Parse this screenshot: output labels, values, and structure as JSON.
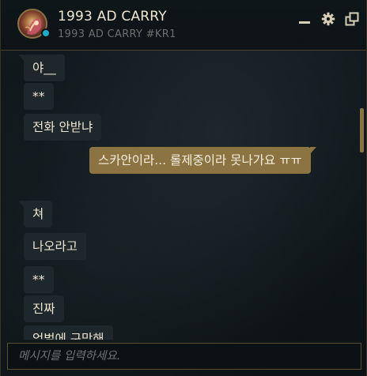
{
  "header": {
    "title": "1993 AD CARRY",
    "subtitle": "1993 AD CARRY #KR1",
    "status": "online",
    "status_color": "#1ab0c9",
    "icons": [
      "minimize-icon",
      "gear-icon",
      "popout-icon"
    ]
  },
  "messages": [
    {
      "dir": "in",
      "text": "야__"
    },
    {
      "dir": "in",
      "text": "**"
    },
    {
      "dir": "in",
      "text": "전화 안받냐"
    },
    {
      "dir": "out",
      "text": "스카안이라... 롤제중이라 못나가요 ㅠㅠ"
    },
    {
      "dir": "in",
      "text": "쳐"
    },
    {
      "dir": "in",
      "text": "나오라고"
    },
    {
      "dir": "in",
      "text": "**"
    },
    {
      "dir": "in",
      "text": "진짜"
    },
    {
      "dir": "in",
      "text": "엄벌에 구막해"
    }
  ],
  "input": {
    "placeholder": "메시지를 입력하세요."
  },
  "colors": {
    "accent": "#8c7442",
    "border_gold": "#5c4d30",
    "text": "#f0e6d2"
  }
}
